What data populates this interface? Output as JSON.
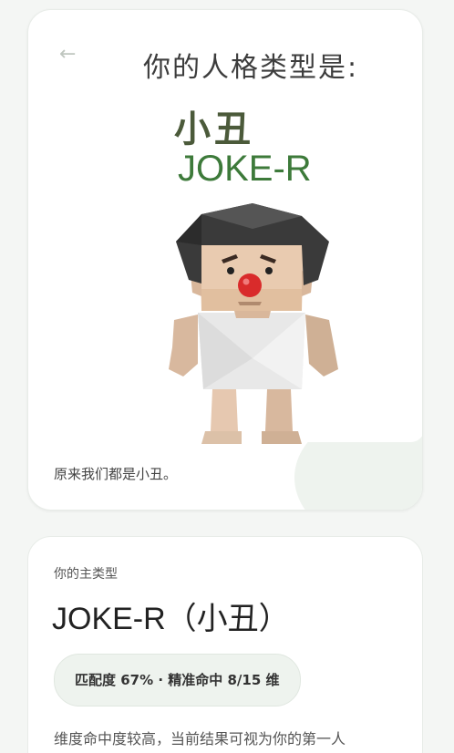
{
  "result_card": {
    "headline": "你的人格类型是:",
    "type_cn": "小丑",
    "type_en": "JOKE-R",
    "caption": "原来我们都是小丑。"
  },
  "summary_card": {
    "subtitle": "你的主类型",
    "main_type": "JOKE-R（小丑）",
    "match_pill": "匹配度 67% · 精准命中 8/15 维",
    "description": "维度命中度较高，当前结果可视为你的第一人"
  },
  "colors": {
    "type_cn": "#4b5a3a",
    "type_en": "#3d7a3a",
    "pill_bg": "#eef3ee",
    "clown_nose": "#d92b2b"
  }
}
